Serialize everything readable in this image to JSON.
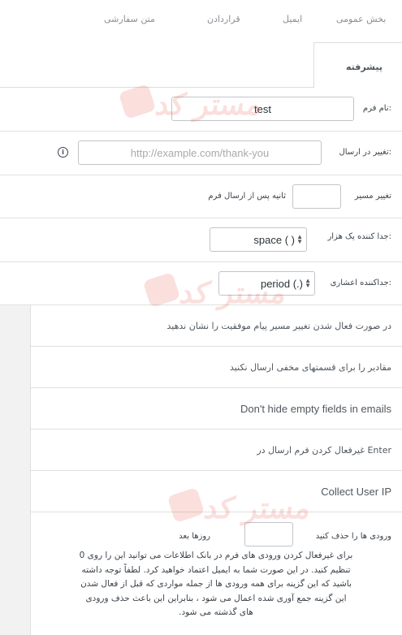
{
  "tabs": {
    "custom_text": "متن سفارشی",
    "contracts": "قراردادن",
    "email": "ایمیل",
    "general": "بخش عمومی",
    "advanced": "پیشرفته"
  },
  "form_name": {
    "label": "نام فرم:",
    "value": "test"
  },
  "redirect": {
    "label": "تغییر در ارسال:",
    "placeholder": "http://example.com/thank-you",
    "info_icon": "i"
  },
  "redirect_delay": {
    "label_before": "تغییر مسیر",
    "label_after": "ثانیه پس از ارسال فرم",
    "value": ""
  },
  "thousand_separator": {
    "label": "جدا کننده یک هزار:",
    "value": "space ( )"
  },
  "decimal_separator": {
    "label": "جداکننده اعشاری:",
    "value": "period (.)"
  },
  "toggles": [
    "در صورت فعال شدن تغییر مسیر پیام موفقیت را نشان ندهید",
    "مقادیر را برای قسمتهای مخفی ارسال نکنید",
    "Don't hide empty fields in emails",
    "غیرفعال کردن فرم ارسال در Enter",
    "Collect User IP"
  ],
  "delete_entries": {
    "label_before": "ورودی ها را حذف کنید",
    "label_after": "روزها بعد",
    "value": "",
    "help_lines": [
      "برای غیرفعال کردن ورودی های فرم در بانک اطلاعات می توانید این را روی 0",
      "تنظیم کنید. در این صورت شما به ایمیل اعتماد خواهید کرد. لطفاً توجه داشته",
      "باشید که این گزینه برای همه ورودی ها از جمله مواردی که قبل از فعال شدن",
      "این گزینه جمع آوری شده اعمال می شود ، بنابراین این باعث حذف ورودی",
      "های گذشته می شود."
    ]
  },
  "watermark": {
    "text": "مستر کد",
    "icon": "logo-mark-icon"
  }
}
